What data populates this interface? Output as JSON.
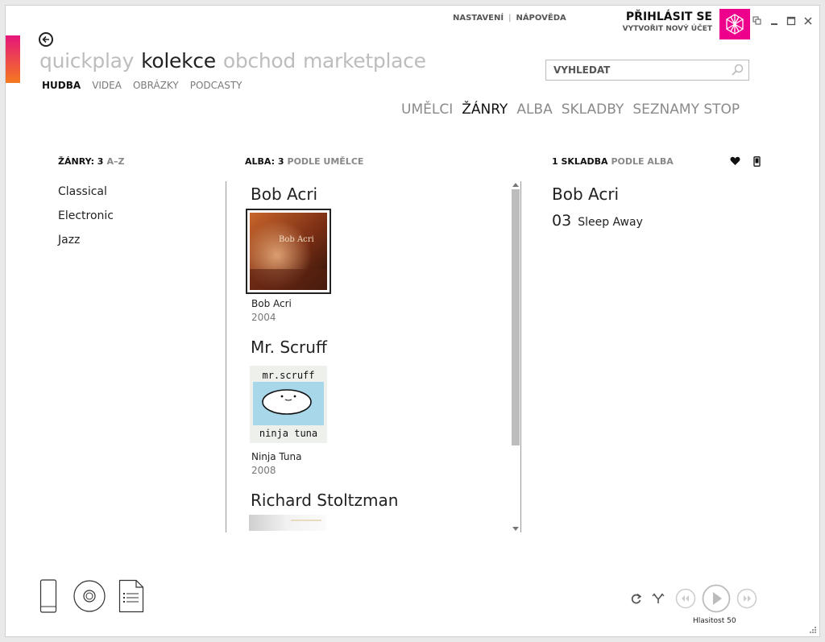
{
  "top_links": {
    "settings": "NASTAVENÍ",
    "separator": "|",
    "help": "NÁPOVĚDA"
  },
  "account": {
    "sign_in": "PŘIHLÁSIT SE",
    "create": "VYTVOŘIT NOVÝ ÚČET"
  },
  "pivots": [
    {
      "label": "quickplay",
      "active": false
    },
    {
      "label": "kolekce",
      "active": true
    },
    {
      "label": "obchod",
      "active": false
    },
    {
      "label": "marketplace",
      "active": false
    }
  ],
  "subpivots": [
    {
      "label": "HUDBA",
      "active": true
    },
    {
      "label": "VIDEA",
      "active": false
    },
    {
      "label": "OBRÁZKY",
      "active": false
    },
    {
      "label": "PODCASTY",
      "active": false
    }
  ],
  "search": {
    "placeholder": "VYHLEDAT"
  },
  "views": [
    {
      "label": "UMĚLCI",
      "active": false
    },
    {
      "label": "ŽÁNRY",
      "active": true
    },
    {
      "label": "ALBA",
      "active": false
    },
    {
      "label": "SKLADBY",
      "active": false
    },
    {
      "label": "SEZNAMY STOP",
      "active": false
    }
  ],
  "genres_col": {
    "header": "ŽÁNRY: 3",
    "sort": "A–Z",
    "items": [
      "Classical",
      "Electronic",
      "Jazz"
    ]
  },
  "albums_col": {
    "header": "ALBA: 3",
    "sort": "PODLE UMĚLCE",
    "groups": [
      {
        "artist": "Bob Acri",
        "album": "Bob Acri",
        "year": "2004",
        "art_text": "Bob Acri"
      },
      {
        "artist": "Mr. Scruff",
        "album": "Ninja Tuna",
        "year": "2008",
        "art_top": "mr.scruff",
        "art_bottom": "ninja tuna"
      },
      {
        "artist": "Richard Stoltzman"
      }
    ]
  },
  "songs_col": {
    "header": "1 SKLADBA",
    "sort": "PODLE ALBA",
    "artist": "Bob Acri",
    "tracks": [
      {
        "number": "03",
        "title": "Sleep Away"
      }
    ]
  },
  "player": {
    "volume_label": "Hlasitost 50"
  },
  "colors": {
    "accent": "#ec008c",
    "strip_top": "#e6157a",
    "strip_bottom": "#f47a1f"
  }
}
